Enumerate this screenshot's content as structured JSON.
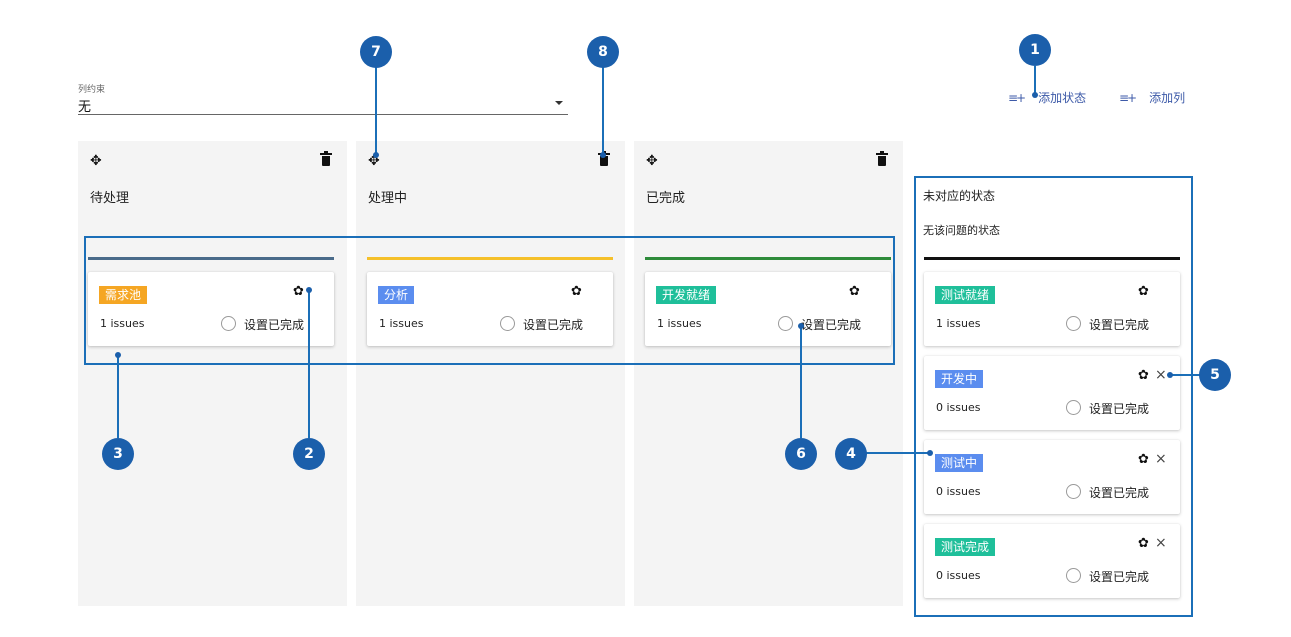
{
  "constraint": {
    "label": "列约束",
    "value": "无"
  },
  "actions": [
    {
      "icon": "add-list-icon",
      "label": "添加状态"
    },
    {
      "icon": "add-list-icon",
      "label": "添加列"
    }
  ],
  "columns": [
    {
      "title": "待处理",
      "bar_color": "#4a6b8a",
      "status": {
        "name": "需求池",
        "color": "#f5a623",
        "issues": "1 issues",
        "done_label": "设置已完成"
      }
    },
    {
      "title": "处理中",
      "bar_color": "#f5c02a",
      "status": {
        "name": "分析",
        "color": "#5b8def",
        "issues": "1 issues",
        "done_label": "设置已完成"
      }
    },
    {
      "title": "已完成",
      "bar_color": "#2e8b3a",
      "status": {
        "name": "开发就绪",
        "color": "#1fbf9a",
        "issues": "1 issues",
        "done_label": "设置已完成"
      }
    }
  ],
  "unmapped": {
    "title": "未对应的状态",
    "subtitle": "无该问题的状态",
    "statuses": [
      {
        "name": "测试就绪",
        "color": "#1fbf9a",
        "issues": "1 issues",
        "done_label": "设置已完成",
        "removable": false
      },
      {
        "name": "开发中",
        "color": "#5b8def",
        "issues": "0 issues",
        "done_label": "设置已完成",
        "removable": true
      },
      {
        "name": "测试中",
        "color": "#5b8def",
        "issues": "0 issues",
        "done_label": "设置已完成",
        "removable": true
      },
      {
        "name": "测试完成",
        "color": "#1fbf9a",
        "issues": "0 issues",
        "done_label": "设置已完成",
        "removable": true
      }
    ]
  },
  "callouts": [
    "1",
    "2",
    "3",
    "4",
    "5",
    "6",
    "7",
    "8"
  ],
  "icons": {
    "move": "move-arrows-icon",
    "delete": "trash-icon",
    "settings": "gear-icon",
    "remove": "close-icon"
  },
  "colors": {
    "accent": "#1b5fab",
    "link": "#3d5aa8"
  }
}
